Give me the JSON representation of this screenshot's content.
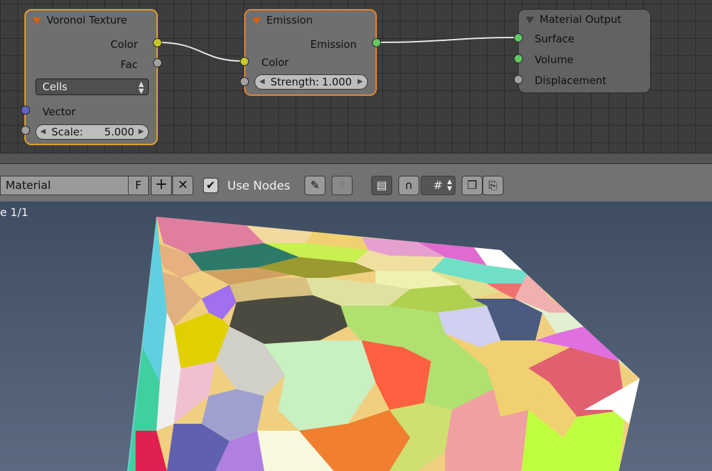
{
  "node_editor": {
    "voronoi": {
      "title": "Voronoi Texture",
      "outputs": [
        "Color",
        "Fac"
      ],
      "coloring_select": "Cells",
      "input_vector": "Vector",
      "scale_label": "Scale:",
      "scale_value": "5.000"
    },
    "emission": {
      "title": "Emission",
      "output": "Emission",
      "input_color": "Color",
      "strength_label": "Strength:",
      "strength_value": "1.000"
    },
    "material_output": {
      "title": "Material Output",
      "inputs": [
        "Surface",
        "Volume",
        "Displacement"
      ]
    }
  },
  "header": {
    "material_name": "Material",
    "fake_user_label": "F",
    "use_nodes_label": "Use Nodes",
    "use_nodes_checked": true
  },
  "viewport": {
    "frame_text": "e 1/1"
  },
  "colors": {
    "socket_color": "#c7c729",
    "socket_float": "#a1a1a1",
    "socket_shader": "#63c763",
    "socket_vector": "#6363c7",
    "active_node_border": "#e8832a"
  }
}
